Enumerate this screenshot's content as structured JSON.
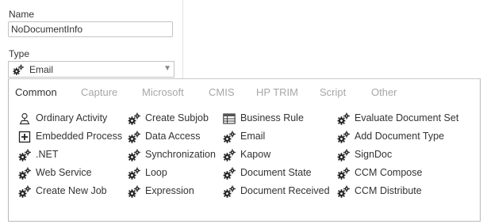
{
  "form": {
    "name_label": "Name",
    "name_value": "NoDocumentInfo",
    "type_label": "Type",
    "type_value": "Email",
    "type_icon": "gears-icon"
  },
  "tabs": [
    {
      "label": "Common",
      "active": true
    },
    {
      "label": "Capture",
      "active": false
    },
    {
      "label": "Microsoft",
      "active": false
    },
    {
      "label": "CMIS",
      "active": false
    },
    {
      "label": "HP TRIM",
      "active": false
    },
    {
      "label": "Script",
      "active": false
    },
    {
      "label": "Other",
      "active": false
    }
  ],
  "activity_columns": [
    [
      {
        "label": "Ordinary Activity",
        "icon": "person-icon"
      },
      {
        "label": "Embedded Process",
        "icon": "plus-box-icon"
      },
      {
        "label": ".NET",
        "icon": "gears-icon"
      },
      {
        "label": "Web Service",
        "icon": "gears-icon"
      },
      {
        "label": "Create New Job",
        "icon": "gears-icon"
      }
    ],
    [
      {
        "label": "Create Subjob",
        "icon": "gears-icon"
      },
      {
        "label": "Data Access",
        "icon": "gears-icon"
      },
      {
        "label": "Synchronization",
        "icon": "gears-icon"
      },
      {
        "label": "Loop",
        "icon": "gears-icon"
      },
      {
        "label": "Expression",
        "icon": "gears-icon"
      }
    ],
    [
      {
        "label": "Business Rule",
        "icon": "table-icon"
      },
      {
        "label": "Email",
        "icon": "gears-icon"
      },
      {
        "label": "Kapow",
        "icon": "gears-icon"
      },
      {
        "label": "Document State",
        "icon": "gears-icon"
      },
      {
        "label": "Document Received",
        "icon": "gears-icon"
      }
    ],
    [
      {
        "label": "Evaluate Document Set",
        "icon": "gears-icon"
      },
      {
        "label": "Add Document Type",
        "icon": "gears-icon"
      },
      {
        "label": "SignDoc",
        "icon": "gears-icon"
      },
      {
        "label": "CCM Compose",
        "icon": "gears-icon"
      },
      {
        "label": "CCM Distribute",
        "icon": "gears-icon"
      }
    ]
  ],
  "colors": {
    "text": "#333333",
    "inactive_tab": "#a7a7a7",
    "border": "#c3c3c3"
  }
}
